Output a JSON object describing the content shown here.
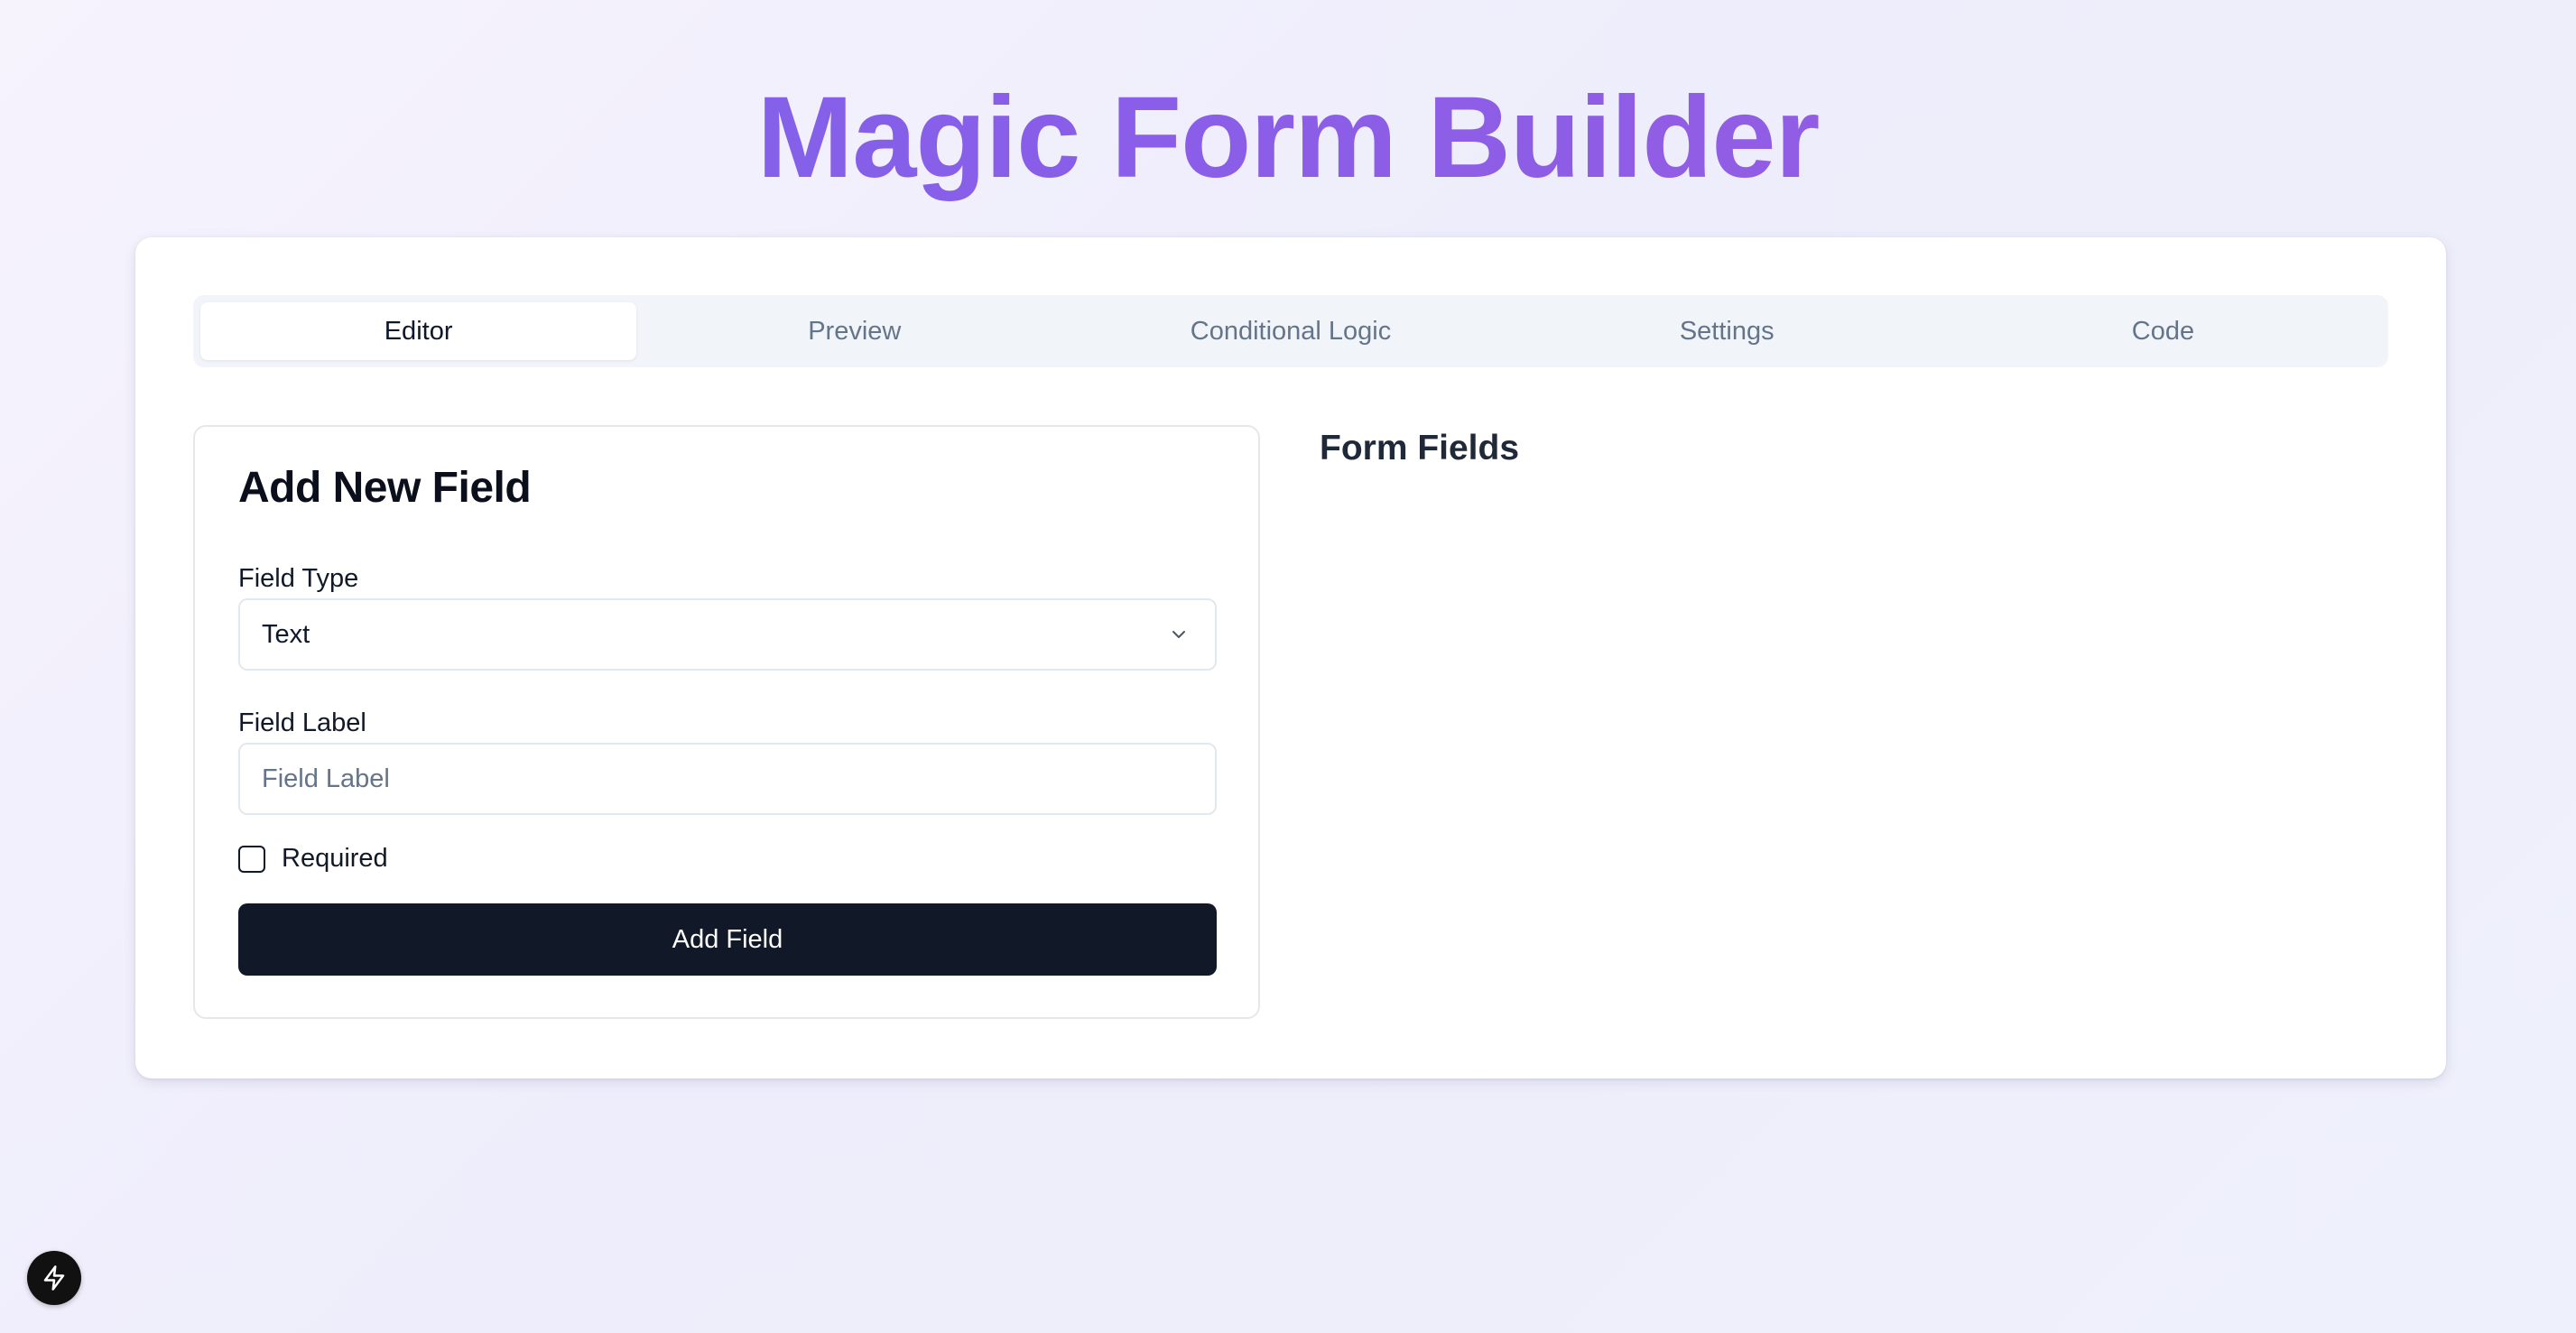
{
  "app": {
    "title": "Magic Form Builder"
  },
  "tabs": [
    {
      "label": "Editor",
      "active": true
    },
    {
      "label": "Preview",
      "active": false
    },
    {
      "label": "Conditional Logic",
      "active": false
    },
    {
      "label": "Settings",
      "active": false
    },
    {
      "label": "Code",
      "active": false
    }
  ],
  "add_field_panel": {
    "title": "Add New Field",
    "field_type": {
      "label": "Field Type",
      "selected_value": "Text",
      "icon": "chevron-down-icon"
    },
    "field_label": {
      "label": "Field Label",
      "value": "",
      "placeholder": "Field Label"
    },
    "required": {
      "label": "Required",
      "checked": false
    },
    "submit_label": "Add Field"
  },
  "form_fields": {
    "heading": "Form Fields"
  },
  "floating_button": {
    "icon": "lightning-bolt-icon"
  },
  "colors": {
    "title_gradient_start": "#7a63ec",
    "title_gradient_end": "#9a5bde",
    "primary_button": "#111827",
    "tab_bar_background": "#f1f5f9"
  }
}
